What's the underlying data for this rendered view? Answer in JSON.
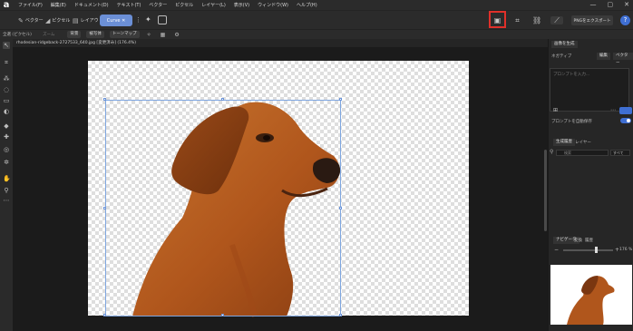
{
  "app": {
    "logo": "a",
    "menus": [
      "ファイル(F)",
      "編集(E)",
      "ドキュメント(D)",
      "テキスト(T)",
      "ベクター",
      "ピクセル",
      "レイヤー(L)",
      "表示(V)",
      "ウィンドウ(W)",
      "ヘルプ(H)"
    ],
    "window_controls": [
      "—",
      "▢",
      "✕"
    ]
  },
  "toolbar": {
    "vector_label": "ベクター",
    "pixel_label": "ピクセル",
    "layout_label": "レイアウト",
    "curve_label": "Curve ✕",
    "export_label": "PNGをエクスポート",
    "help_label": "?"
  },
  "optionbar": {
    "mode_label": "全選 (ピクセル)",
    "hint": "ズーム",
    "pill1": "背景",
    "pill2": "被写体",
    "pill3": "トーンマップ"
  },
  "document": {
    "tab_title": "rhodesian-ridgeback-2727533_640.jpg [変更済み] (176.4%)"
  },
  "right_panel": {
    "section_title": "画像を生成",
    "prompt_tabs": [
      "編集",
      "ベクター"
    ],
    "prompt_label": "ネガティブ",
    "prompt_placeholder": "プロンプトを入力...",
    "toggle_label": "プロンプトを自動保存",
    "layers_tabs": [
      "生成履歴",
      "レイヤー"
    ],
    "search_placeholder": "検索",
    "filter_value": "すべて",
    "navigator_tabs": [
      "ナビゲータ",
      "変換",
      "履歴"
    ],
    "zoom_value": "176 %"
  }
}
